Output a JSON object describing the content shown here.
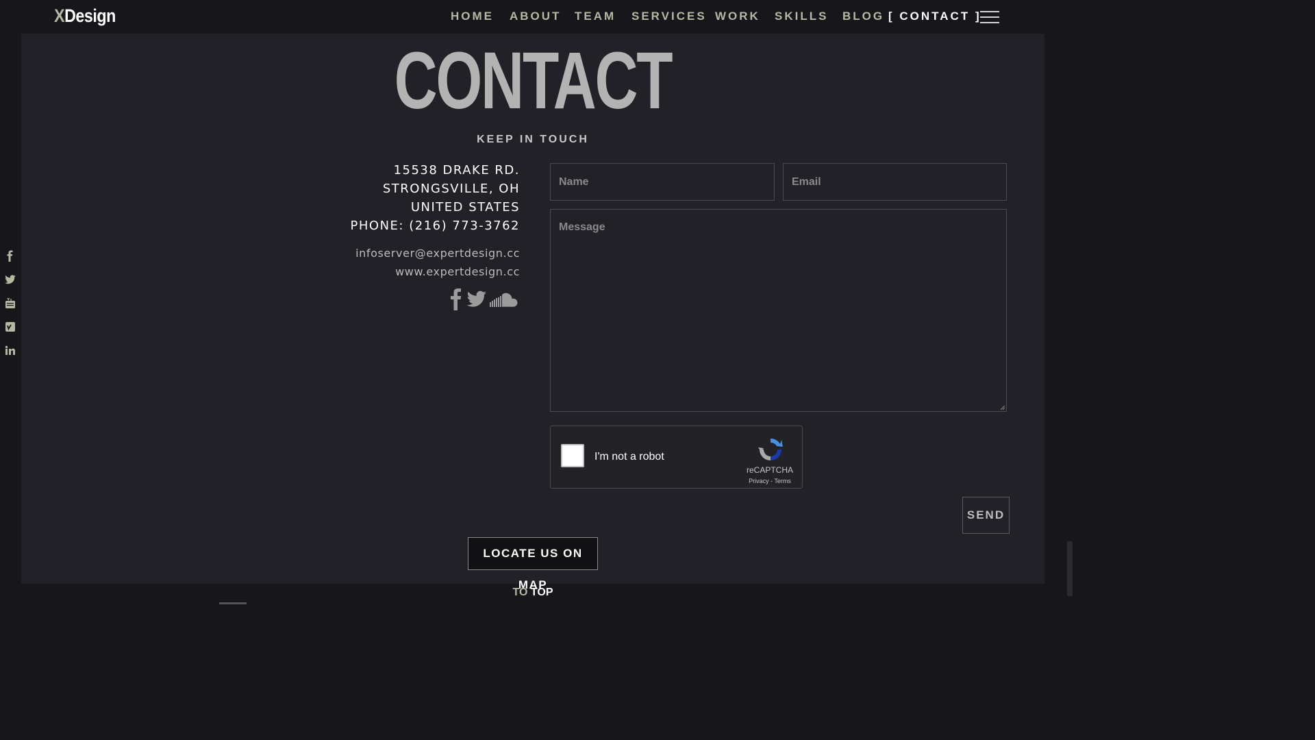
{
  "brand": {
    "logo_x": "X",
    "logo_rest": "Design"
  },
  "nav": {
    "items": [
      {
        "label": "HOME"
      },
      {
        "label": "ABOUT"
      },
      {
        "label": "TEAM"
      },
      {
        "label": "SERVICES"
      },
      {
        "label": "WORK"
      },
      {
        "label": "SKILLS"
      },
      {
        "label": "BLOG"
      },
      {
        "label": "[ CONTACT ]",
        "active": true
      }
    ]
  },
  "social_rail": [
    "facebook-icon",
    "twitter-icon",
    "youtube-icon",
    "vimeo-icon",
    "linkedin-icon"
  ],
  "section": {
    "title": "CONTACT",
    "subtitle": "KEEP IN TOUCH"
  },
  "address": {
    "street": "15538 DRAKE RD.",
    "city": "STRONGSVILLE, OH",
    "country": "UNITED STATES",
    "phone": "PHONE: (216) 773-3762"
  },
  "links": {
    "email": "infoserver@expertdesign.cc",
    "website": "www.expertdesign.cc"
  },
  "social_big": [
    "facebook-icon",
    "twitter-icon",
    "soundcloud-icon"
  ],
  "form": {
    "name_placeholder": "Name",
    "email_placeholder": "Email",
    "message_placeholder": "Message",
    "send_label": "SEND"
  },
  "captcha": {
    "label": "I'm not a robot",
    "brand": "reCAPTCHA",
    "terms": "Privacy - Terms"
  },
  "map_button": "LOCATE US ON MAP",
  "to_top": {
    "to": "TO",
    "top": "TOP"
  },
  "colors": {
    "background": "#17171b",
    "panel": "#212127",
    "accent": "#b7b8a3",
    "title_gray": "#b3b3b3",
    "captcha_blue": "#1c3aa9"
  }
}
